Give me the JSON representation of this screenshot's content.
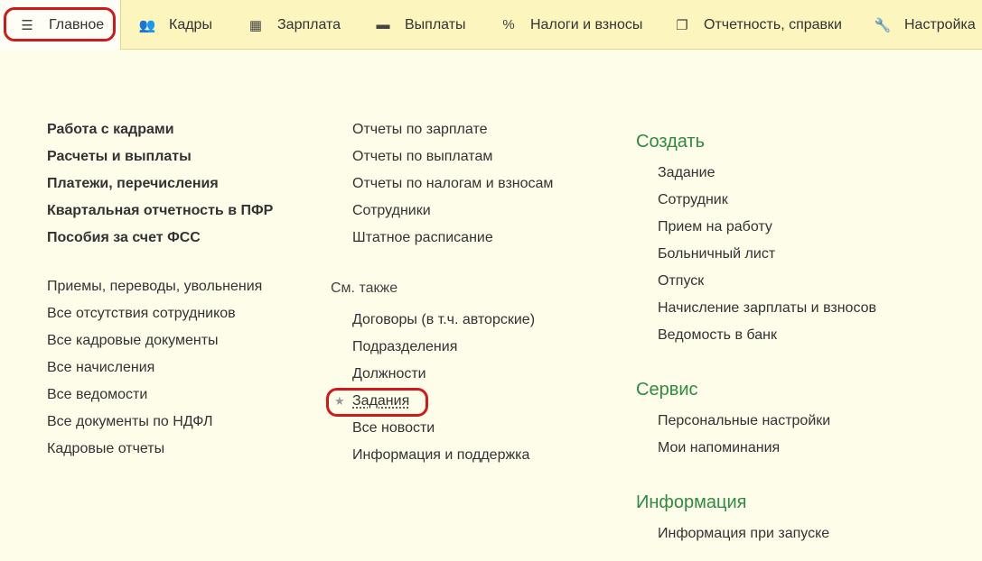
{
  "tabs": [
    {
      "label": "Главное",
      "icon": "menu-icon"
    },
    {
      "label": "Кадры",
      "icon": "people-icon"
    },
    {
      "label": "Зарплата",
      "icon": "calculator-icon"
    },
    {
      "label": "Выплаты",
      "icon": "wallet-icon"
    },
    {
      "label": "Налоги и взносы",
      "icon": "percent-icon"
    },
    {
      "label": "Отчетность, справки",
      "icon": "documents-icon"
    },
    {
      "label": "Настройка",
      "icon": "wrench-icon"
    }
  ],
  "col1": {
    "bold_links": [
      "Работа с кадрами",
      "Расчеты и выплаты",
      "Платежи, перечисления",
      "Квартальная отчетность в ПФР",
      "Пособия за счет ФСС"
    ],
    "links": [
      "Приемы, переводы, увольнения",
      "Все отсутствия сотрудников",
      "Все кадровые документы",
      "Все начисления",
      "Все ведомости",
      "Все документы по НДФЛ",
      "Кадровые отчеты"
    ]
  },
  "col2": {
    "links": [
      "Отчеты по зарплате",
      "Отчеты по выплатам",
      "Отчеты по налогам и взносам",
      "Сотрудники",
      "Штатное расписание"
    ],
    "see_also_label": "См. также",
    "see_also": [
      "Договоры (в т.ч. авторские)",
      "Подразделения",
      "Должности",
      "Задания",
      "Все новости",
      "Информация и поддержка"
    ],
    "star_glyph": "★"
  },
  "col3": {
    "create_title": "Создать",
    "create": [
      "Задание",
      "Сотрудник",
      "Прием на работу",
      "Больничный лист",
      "Отпуск",
      "Начисление зарплаты и взносов",
      "Ведомость в банк"
    ],
    "service_title": "Сервис",
    "service": [
      "Персональные настройки",
      "Мои напоминания"
    ],
    "info_title": "Информация",
    "info": [
      "Информация при запуске"
    ]
  },
  "colors": {
    "accent_green": "#2f8a42",
    "highlight_red": "#d0191b",
    "topbar_bg": "#fcf5bd",
    "page_bg": "#fdfde9"
  }
}
